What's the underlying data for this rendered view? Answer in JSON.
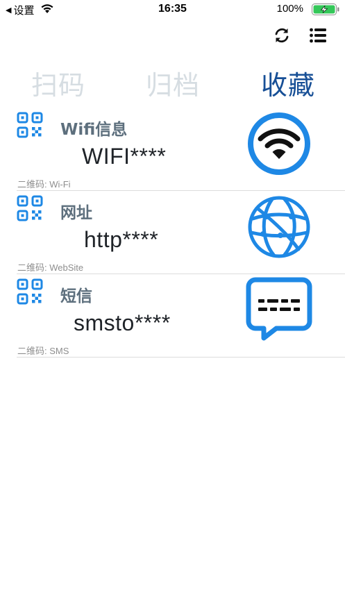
{
  "status_bar": {
    "back_label": "设置",
    "time": "16:35",
    "battery_percent": "100%"
  },
  "toolbar": {
    "refresh_icon": "refresh-icon",
    "menu_icon": "list-menu-icon"
  },
  "tabs": [
    {
      "label": "扫码",
      "active": false
    },
    {
      "label": "归档",
      "active": false
    },
    {
      "label": "收藏",
      "active": true
    }
  ],
  "items": [
    {
      "title": "Wifi信息",
      "value": "WIFI****",
      "caption": "二维码: Wi-Fi",
      "icon": "wifi-icon"
    },
    {
      "title": "网址",
      "value": "http****",
      "caption": "二维码: WebSite",
      "icon": "globe-icon"
    },
    {
      "title": "短信",
      "value": "smsto****",
      "caption": "二维码: SMS",
      "icon": "message-icon"
    }
  ],
  "colors": {
    "accent": "#1e88e5",
    "active_tab": "#174f96",
    "inactive_tab": "#d6dde2",
    "battery_green": "#34c759"
  }
}
